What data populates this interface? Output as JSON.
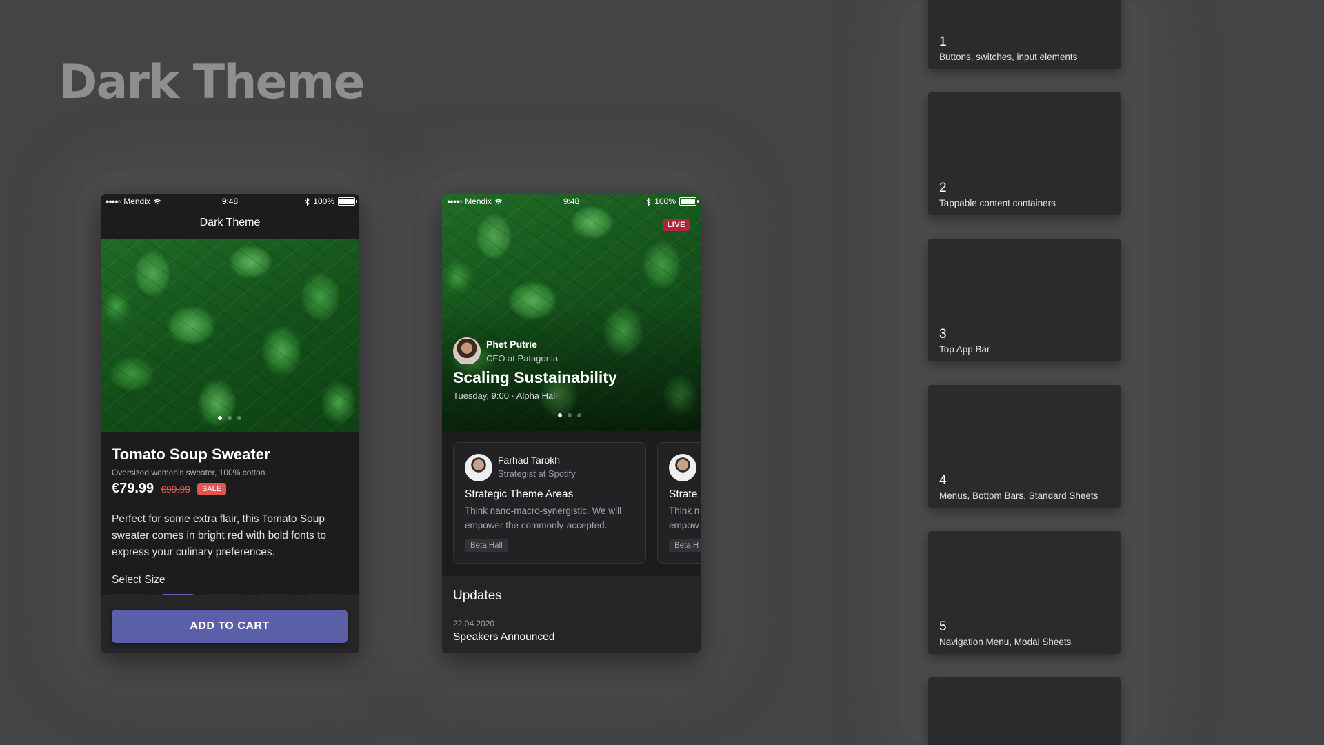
{
  "page": {
    "title": "Dark Theme"
  },
  "status_bar": {
    "carrier": "Mendix",
    "time": "9:48",
    "battery": "100%"
  },
  "product_screen": {
    "header_title": "Dark Theme",
    "product_name": "Tomato Soup Sweater",
    "product_subtitle": "Oversized women's sweater, 100% cotton",
    "price": "€79.99",
    "old_price": "€99.99",
    "badge": "SALE",
    "description": "Perfect for some extra flair, this Tomato Soup sweater comes in bright red with bold fonts to express your culinary preferences.",
    "select_size_label": "Select Size",
    "cta_label": "ADD TO CART",
    "carousel_active_index": 0,
    "carousel_count": 3
  },
  "event_screen": {
    "live_badge": "LIVE",
    "hero": {
      "speaker_name": "Phet Putrie",
      "speaker_role": "CFO at Patagonia",
      "title": "Scaling Sustainability",
      "meta": "Tuesday, 9:00 · Alpha Hall"
    },
    "sessions": [
      {
        "speaker_name": "Farhad Tarokh",
        "speaker_role": "Strategist at Spotify",
        "title": "Strategic Theme Areas",
        "text": "Think nano-macro-synergistic. We will empower the commonly-accepted.",
        "tag": "Beta Hall"
      },
      {
        "title": "Strate",
        "text": "Think n\nempow",
        "tag": "Beta H"
      }
    ],
    "updates_title": "Updates",
    "update_date": "22.04.2020",
    "update_headline": "Speakers Announced"
  },
  "categories": [
    {
      "number": "1",
      "label": "Buttons, switches, input elements"
    },
    {
      "number": "2",
      "label": "Tappable content containers"
    },
    {
      "number": "3",
      "label": "Top App Bar"
    },
    {
      "number": "4",
      "label": "Menus, Bottom Bars, Standard Sheets"
    },
    {
      "number": "5",
      "label": "Navigation Menu, Modal Sheets"
    }
  ],
  "colors": {
    "background": "#444446",
    "surface": "#1c1c1e",
    "accent": "#5a5fa8",
    "sale": "#e5534b",
    "live": "#b3243a"
  }
}
